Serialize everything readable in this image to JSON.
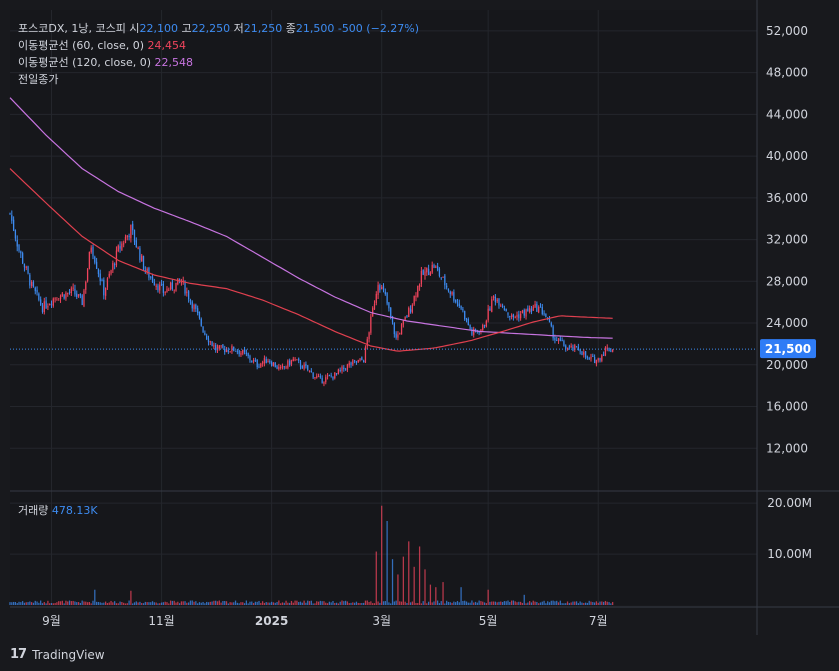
{
  "header": {
    "symbol": "포스코DX, 1낭, 코스피",
    "open_label": "시",
    "open": "22,100",
    "high_label": "고",
    "high": "22,250",
    "low_label": "저",
    "low": "21,250",
    "close_label": "종",
    "close": "21,500",
    "change": "-500 (−2.27%)"
  },
  "indicators": {
    "ma60_label": "이동평균선 (60, close, 0)",
    "ma60_value": "24,454",
    "ma120_label": "이동평균선 (120, close, 0)",
    "ma120_value": "22,548",
    "prev_close_label": "전일종가"
  },
  "volume": {
    "label": "거래량",
    "value": "478.13K"
  },
  "price_badge": "21,500",
  "brand": "TradingView",
  "colors": {
    "up": "#f0445c",
    "down": "#3d8bf0",
    "ma60": "#e0404f",
    "ma120": "#c774e0",
    "background": "#18191d"
  },
  "chart_data": {
    "type": "candlestick",
    "y_ticks": [
      "52,000",
      "48,000",
      "44,000",
      "40,000",
      "36,000",
      "32,000",
      "28,000",
      "24,000",
      "20,000",
      "16,000",
      "12,000"
    ],
    "y_tick_values": [
      52000,
      48000,
      44000,
      40000,
      36000,
      32000,
      28000,
      24000,
      20000,
      16000,
      12000
    ],
    "ylim": [
      8000,
      54000
    ],
    "volume_ticks": [
      "20.00M",
      "10.00M"
    ],
    "volume_tick_values": [
      20000000,
      10000000
    ],
    "volume_ylim": [
      0,
      22000000
    ],
    "x_ticks": [
      "9월",
      "11월",
      "2025",
      "3월",
      "5월",
      "7월"
    ],
    "x_tick_days": [
      23,
      84,
      145,
      206,
      265,
      326
    ],
    "x_range_days": [
      0,
      414
    ],
    "last_day": 334,
    "close_anchors": [
      [
        0,
        34500
      ],
      [
        5,
        31000
      ],
      [
        12,
        27500
      ],
      [
        18,
        25500
      ],
      [
        25,
        26500
      ],
      [
        35,
        27000
      ],
      [
        40,
        26000
      ],
      [
        45,
        31500
      ],
      [
        52,
        27000
      ],
      [
        60,
        31000
      ],
      [
        67,
        33000
      ],
      [
        75,
        29000
      ],
      [
        85,
        27000
      ],
      [
        95,
        28000
      ],
      [
        102,
        25500
      ],
      [
        108,
        23000
      ],
      [
        114,
        21500
      ],
      [
        125,
        21500
      ],
      [
        130,
        21000
      ],
      [
        137,
        20000
      ],
      [
        143,
        20500
      ],
      [
        150,
        19500
      ],
      [
        157,
        20500
      ],
      [
        165,
        19500
      ],
      [
        172,
        18500
      ],
      [
        180,
        19000
      ],
      [
        188,
        20000
      ],
      [
        196,
        20500
      ],
      [
        204,
        28000
      ],
      [
        208,
        26500
      ],
      [
        214,
        22500
      ],
      [
        222,
        25500
      ],
      [
        228,
        28500
      ],
      [
        235,
        29500
      ],
      [
        242,
        27500
      ],
      [
        250,
        25500
      ],
      [
        256,
        23000
      ],
      [
        262,
        23500
      ],
      [
        268,
        26500
      ],
      [
        272,
        26000
      ],
      [
        278,
        24500
      ],
      [
        285,
        25000
      ],
      [
        292,
        25500
      ],
      [
        296,
        25000
      ],
      [
        302,
        22500
      ],
      [
        310,
        21500
      ],
      [
        316,
        21500
      ],
      [
        320,
        20500
      ],
      [
        326,
        20500
      ],
      [
        330,
        21500
      ],
      [
        334,
        21500
      ]
    ],
    "ma60_anchors": [
      [
        0,
        38800
      ],
      [
        20,
        35500
      ],
      [
        40,
        32300
      ],
      [
        60,
        30000
      ],
      [
        80,
        28600
      ],
      [
        100,
        27800
      ],
      [
        120,
        27300
      ],
      [
        140,
        26200
      ],
      [
        160,
        24800
      ],
      [
        180,
        23200
      ],
      [
        200,
        21800
      ],
      [
        215,
        21300
      ],
      [
        235,
        21600
      ],
      [
        255,
        22300
      ],
      [
        275,
        23300
      ],
      [
        290,
        24100
      ],
      [
        305,
        24700
      ],
      [
        315,
        24600
      ],
      [
        334,
        24454
      ]
    ],
    "ma120_anchors": [
      [
        0,
        45600
      ],
      [
        20,
        42000
      ],
      [
        40,
        38800
      ],
      [
        60,
        36600
      ],
      [
        80,
        35000
      ],
      [
        100,
        33700
      ],
      [
        120,
        32300
      ],
      [
        140,
        30300
      ],
      [
        160,
        28300
      ],
      [
        180,
        26500
      ],
      [
        200,
        25000
      ],
      [
        220,
        24200
      ],
      [
        240,
        23700
      ],
      [
        260,
        23200
      ],
      [
        280,
        23000
      ],
      [
        300,
        22800
      ],
      [
        320,
        22620
      ],
      [
        334,
        22548
      ]
    ],
    "volume_spikes": [
      [
        47,
        3.0
      ],
      [
        67,
        2.8
      ],
      [
        203,
        10.5
      ],
      [
        206,
        19.5
      ],
      [
        209,
        16.5
      ],
      [
        212,
        9.0
      ],
      [
        215,
        6.0
      ],
      [
        218,
        9.5
      ],
      [
        221,
        12.5
      ],
      [
        224,
        7.5
      ],
      [
        227,
        11.5
      ],
      [
        230,
        7.0
      ],
      [
        233,
        4.0
      ],
      [
        236,
        3.5
      ],
      [
        240,
        4.5
      ],
      [
        250,
        3.5
      ],
      [
        265,
        3.0
      ],
      [
        285,
        2.0
      ]
    ],
    "volume_base": 0.6,
    "prev_close": 22000
  }
}
